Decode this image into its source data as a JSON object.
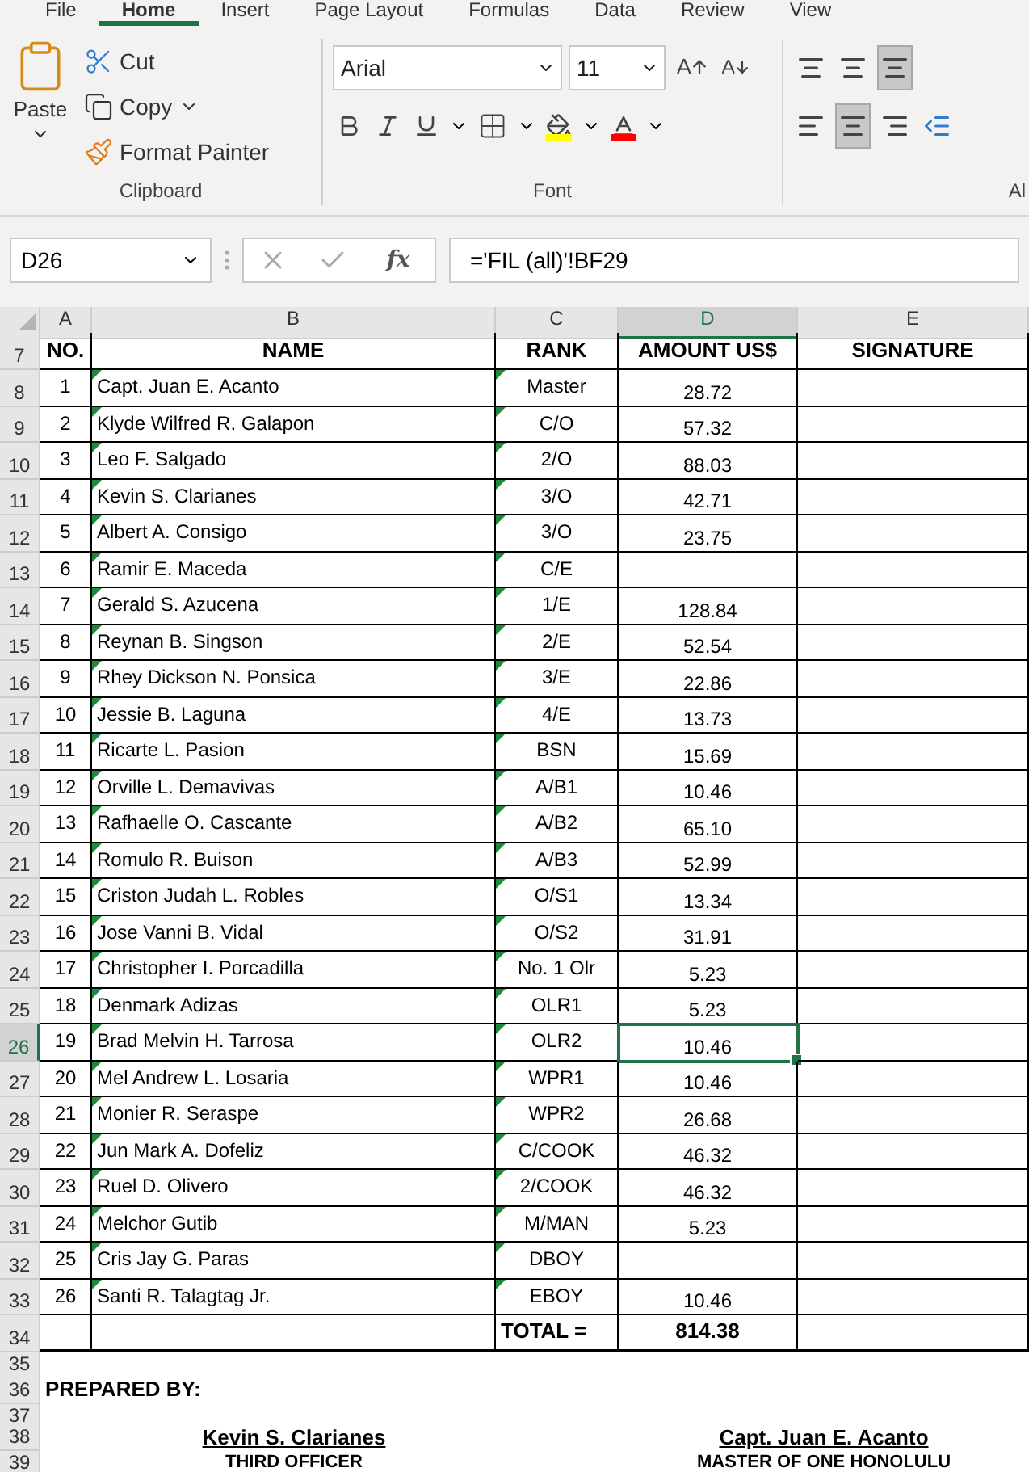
{
  "ribbon_tabs": [
    {
      "label": "File",
      "selected": false
    },
    {
      "label": "Home",
      "selected": true
    },
    {
      "label": "Insert",
      "selected": false
    },
    {
      "label": "Page Layout",
      "selected": false
    },
    {
      "label": "Formulas",
      "selected": false
    },
    {
      "label": "Data",
      "selected": false
    },
    {
      "label": "Review",
      "selected": false
    },
    {
      "label": "View",
      "selected": false
    }
  ],
  "clipboard": {
    "paste": "Paste",
    "cut": "Cut",
    "copy": "Copy",
    "format_painter": "Format Painter",
    "label": "Clipboard"
  },
  "font": {
    "name": "Arial",
    "size": "11",
    "label": "Font"
  },
  "alignment": {
    "label": "Al"
  },
  "formula_bar": {
    "name_box": "D26",
    "fx": "fx",
    "formula": "='FIL (all)'!BF29"
  },
  "sheet": {
    "columns": [
      {
        "label": "A",
        "selected": false
      },
      {
        "label": "B",
        "selected": false
      },
      {
        "label": "C",
        "selected": false
      },
      {
        "label": "D",
        "selected": true
      },
      {
        "label": "E",
        "selected": false
      }
    ],
    "header": {
      "row": "7",
      "cells": [
        "NO.",
        "NAME",
        "RANK",
        "AMOUNT US$",
        "SIGNATURE"
      ]
    },
    "rows": [
      {
        "row": "8",
        "no": "1",
        "name": "Capt. Juan E. Acanto",
        "rank": "Master",
        "amount": "28.72",
        "selected": false
      },
      {
        "row": "9",
        "no": "2",
        "name": "Klyde Wilfred R. Galapon",
        "rank": "C/O",
        "amount": "57.32",
        "selected": false
      },
      {
        "row": "10",
        "no": "3",
        "name": "Leo F. Salgado",
        "rank": "2/O",
        "amount": "88.03",
        "selected": false
      },
      {
        "row": "11",
        "no": "4",
        "name": "Kevin S. Clarianes",
        "rank": "3/O",
        "amount": "42.71",
        "selected": false
      },
      {
        "row": "12",
        "no": "5",
        "name": "Albert A. Consigo",
        "rank": "3/O",
        "amount": "23.75",
        "selected": false
      },
      {
        "row": "13",
        "no": "6",
        "name": "Ramir E. Maceda",
        "rank": "C/E",
        "selected": false
      },
      {
        "row": "14",
        "no": "7",
        "name": "Gerald S. Azucena",
        "rank": "1/E",
        "amount": "128.84",
        "selected": false
      },
      {
        "row": "15",
        "no": "8",
        "name": "Reynan B. Singson",
        "rank": "2/E",
        "amount": "52.54",
        "selected": false
      },
      {
        "row": "16",
        "no": "9",
        "name": "Rhey Dickson N. Ponsica",
        "rank": "3/E",
        "amount": "22.86",
        "selected": false
      },
      {
        "row": "17",
        "no": "10",
        "name": "Jessie B. Laguna",
        "rank": "4/E",
        "amount": "13.73",
        "selected": false
      },
      {
        "row": "18",
        "no": "11",
        "name": "Ricarte L. Pasion",
        "rank": "BSN",
        "amount": "15.69",
        "selected": false
      },
      {
        "row": "19",
        "no": "12",
        "name": "Orville L. Demavivas",
        "rank": "A/B1",
        "amount": "10.46",
        "selected": false
      },
      {
        "row": "20",
        "no": "13",
        "name": "Rafhaelle O. Cascante",
        "rank": "A/B2",
        "amount": "65.10",
        "selected": false
      },
      {
        "row": "21",
        "no": "14",
        "name": "Romulo R. Buison",
        "rank": "A/B3",
        "amount": "52.99",
        "selected": false
      },
      {
        "row": "22",
        "no": "15",
        "name": "Criston Judah L. Robles",
        "rank": "O/S1",
        "amount": "13.34",
        "selected": false
      },
      {
        "row": "23",
        "no": "16",
        "name": "Jose Vanni B. Vidal",
        "rank": "O/S2",
        "amount": "31.91",
        "selected": false
      },
      {
        "row": "24",
        "no": "17",
        "name": "Christopher I. Porcadilla",
        "rank": "No. 1 Olr",
        "amount": "5.23",
        "selected": false
      },
      {
        "row": "25",
        "no": "18",
        "name": "Denmark Adizas",
        "rank": "OLR1",
        "amount": "5.23",
        "selected": false
      },
      {
        "row": "26",
        "no": "19",
        "name": "Brad Melvin H. Tarrosa",
        "rank": "OLR2",
        "amount": "10.46",
        "selected": true
      },
      {
        "row": "27",
        "no": "20",
        "name": "Mel Andrew L. Losaria",
        "rank": "WPR1",
        "amount": "10.46",
        "selected": false
      },
      {
        "row": "28",
        "no": "21",
        "name": "Monier R. Seraspe",
        "rank": "WPR2",
        "amount": "26.68",
        "selected": false
      },
      {
        "row": "29",
        "no": "22",
        "name": "Jun Mark A. Dofeliz",
        "rank": "C/COOK",
        "amount": "46.32",
        "selected": false
      },
      {
        "row": "30",
        "no": "23",
        "name": "Ruel D. Olivero",
        "rank": "2/COOK",
        "amount": "46.32",
        "selected": false
      },
      {
        "row": "31",
        "no": "24",
        "name": "Melchor Gutib",
        "rank": "M/MAN",
        "amount": "5.23",
        "selected": false
      },
      {
        "row": "32",
        "no": "25",
        "name": "Cris Jay G. Paras",
        "rank": "DBOY",
        "selected": false
      },
      {
        "row": "33",
        "no": "26",
        "name": "Santi R. Talagtag Jr.",
        "rank": "EBOY",
        "amount": "10.46",
        "selected": false
      }
    ],
    "total": {
      "row": "34",
      "label": "TOTAL  =",
      "amount": "814.38"
    },
    "footer": [
      {
        "kind": "blank",
        "row": "35"
      },
      {
        "kind": "prepared",
        "row": "36",
        "text": "PREPARED BY:"
      },
      {
        "kind": "blank",
        "row": "37"
      },
      {
        "kind": "names",
        "row": "38",
        "left": "Kevin S. Clarianes",
        "right": "Capt. Juan E. Acanto"
      },
      {
        "kind": "titles",
        "row": "39",
        "left": "THIRD OFFICER",
        "right": "MASTER OF ONE HONOLULU"
      }
    ]
  }
}
